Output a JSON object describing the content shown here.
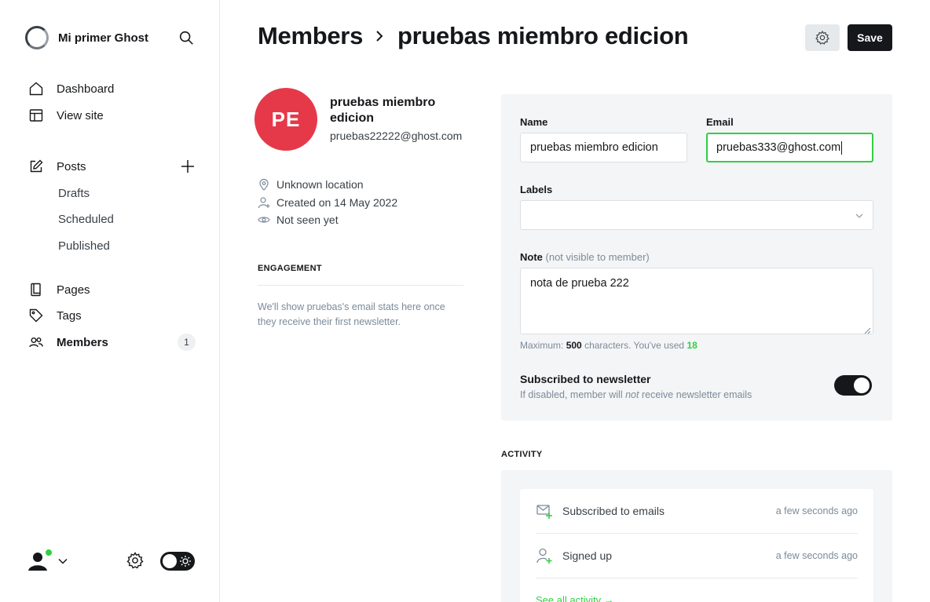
{
  "sidebar": {
    "site_name": "Mi primer Ghost",
    "nav": {
      "dashboard": "Dashboard",
      "view_site": "View site",
      "posts": "Posts",
      "drafts": "Drafts",
      "scheduled": "Scheduled",
      "published": "Published",
      "pages": "Pages",
      "tags": "Tags",
      "members": "Members",
      "members_count": "1"
    }
  },
  "header": {
    "breadcrumb_parent": "Members",
    "breadcrumb_current": "pruebas miembro edicion",
    "save_label": "Save"
  },
  "profile": {
    "initials": "PE",
    "avatar_color": "#e5394a",
    "name": "pruebas miembro edicion",
    "email": "pruebas22222@ghost.com",
    "location": "Unknown location",
    "created": "Created on 14 May 2022",
    "seen": "Not seen yet"
  },
  "engagement": {
    "title": "ENGAGEMENT",
    "text": "We'll show pruebas's email stats here once they receive their first newsletter."
  },
  "form": {
    "name_label": "Name",
    "name_value": "pruebas miembro edicion",
    "email_label": "Email",
    "email_value": "pruebas333@ghost.com",
    "labels_label": "Labels",
    "note_label": "Note",
    "note_hint": "(not visible to member)",
    "note_value": "nota de prueba 222",
    "count_prefix": "Maximum:",
    "count_max": "500",
    "count_mid": "characters. You've used",
    "count_used": "18",
    "newsletter_title": "Subscribed to newsletter",
    "newsletter_desc_1": "If disabled, member will",
    "newsletter_desc_em": "not",
    "newsletter_desc_2": "receive newsletter emails",
    "newsletter_enabled": true
  },
  "activity": {
    "title": "ACTIVITY",
    "items": [
      {
        "text": "Subscribed to emails",
        "time": "a few seconds ago",
        "icon": "email-subscribe-icon"
      },
      {
        "text": "Signed up",
        "time": "a few seconds ago",
        "icon": "user-add-icon"
      }
    ],
    "see_all": "See all activity →"
  },
  "colors": {
    "accent_green": "#30cf43",
    "dark": "#15171a"
  }
}
